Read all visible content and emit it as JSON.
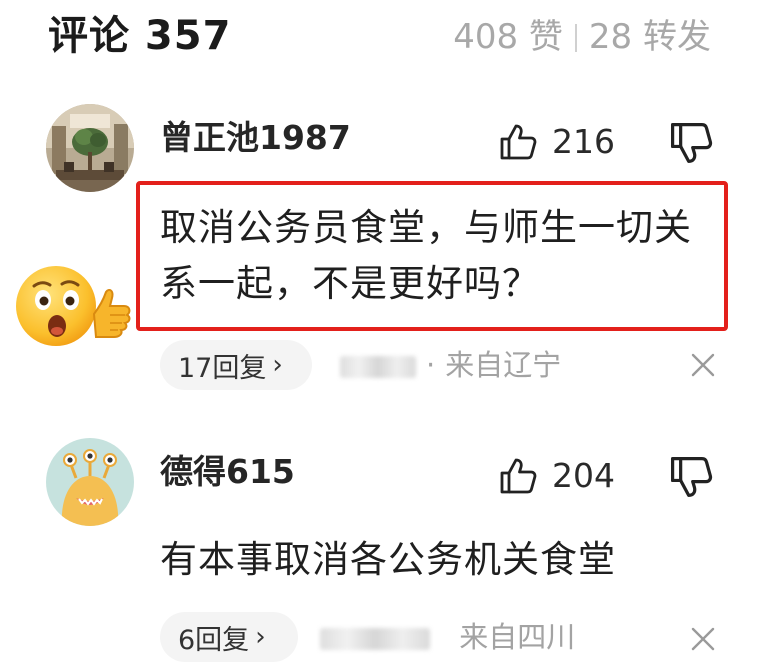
{
  "header": {
    "title": "评论 357",
    "likes": "408 赞",
    "shares": "28 转发"
  },
  "comments": [
    {
      "username": "曾正池1987",
      "likes": "216",
      "text": "取消公务员食堂，与师生一切关系一起，不是更好吗？",
      "reply_label": "17回复",
      "meta_dot": "·",
      "location": "来自辽宁",
      "highlighted": true,
      "avatar": "restaurant-photo"
    },
    {
      "username": "德得615",
      "likes": "204",
      "text": "有本事取消各公务机关食堂",
      "reply_label": "6回复",
      "location": "来自四川",
      "highlighted": false,
      "avatar": "cartoon-monster"
    }
  ],
  "icons": {
    "like": "thumbs-up-outline-icon",
    "dislike": "thumbs-down-outline-icon",
    "close": "close-x-icon",
    "chevron": "›",
    "sticker": "surprised-face-thumbs-up-emoji"
  },
  "colors": {
    "highlight_border": "#e3201b",
    "meta_text": "#a3a3a3",
    "pill_bg": "#f4f4f4"
  }
}
